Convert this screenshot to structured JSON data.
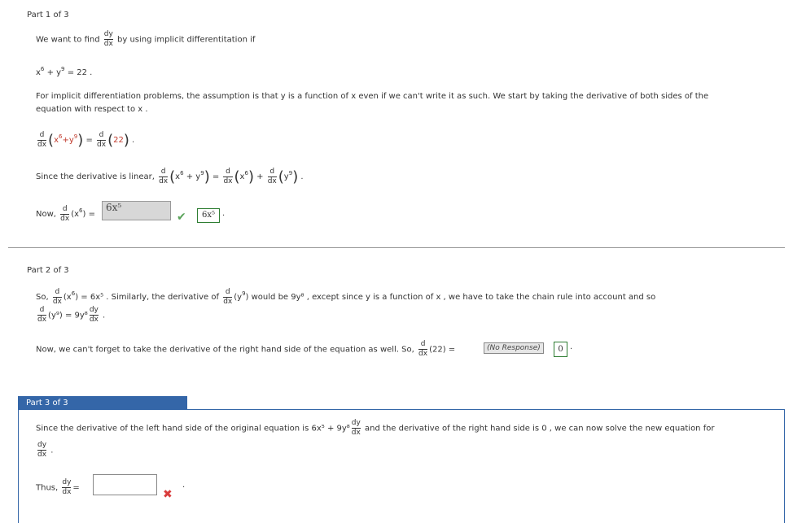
{
  "part1": {
    "label": "Part 1 of 3",
    "intro_a": "We want to find",
    "intro_b": "by using implicit differentitation if",
    "equation": "x6 + y9 = 22 .",
    "para1": "For implicit differentiation problems, the assumption is that  y  is a function of  x  even if we can't write it as such. We start by taking the derivative of both sides of the",
    "para2": "equation with respect to  x .",
    "linear_prefix": "Since the derivative is linear,",
    "now_prefix": "Now,",
    "answer_value": "6x⁵",
    "answer_echo": "6x⁵"
  },
  "part2": {
    "label": "Part 2 of 3",
    "line1_a": "So,",
    "line1_b": "= 6x⁵ . Similarly, the derivative of",
    "line1_c": "would be  9y⁸ , except since  y  is a function of  x , we have to take the chain rule into account and so",
    "line2": "(y⁹) = 9y⁸",
    "line3": "Now, we can't forget to take the derivative of the right hand side of the equation as well. So,",
    "line3_eq": "(22) =",
    "no_response": "(No Response)",
    "response_value": "0"
  },
  "part3": {
    "label": "Part 3 of 3",
    "line1": "Since the derivative of the left hand side of the original equation is  6x⁵ + 9y⁸",
    "line1_b": "and the derivative of the right hand side is  0 , we can now solve the new equation for",
    "thus": "Thus,",
    "eq": "="
  },
  "icons": {
    "check": "check-icon",
    "wrong": "x-icon"
  },
  "colors": {
    "accent": "#3466a8",
    "correct": "#5aa35a",
    "wrong": "#d93c3c"
  }
}
